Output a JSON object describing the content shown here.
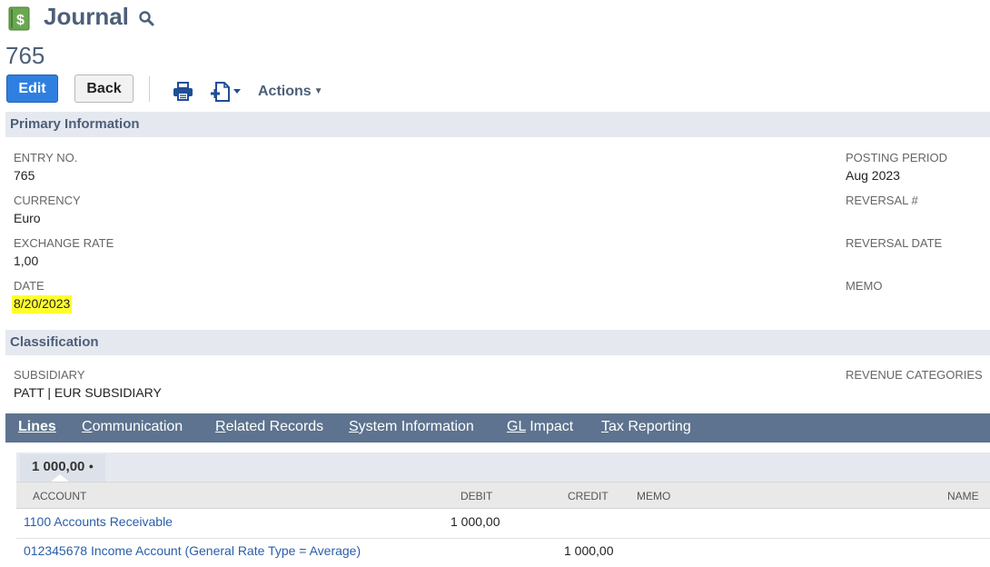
{
  "header": {
    "record_type": "Journal",
    "record_number": "765",
    "record_icon": "dollar-ledger-icon",
    "search_icon": "search-icon"
  },
  "toolbar": {
    "edit_label": "Edit",
    "back_label": "Back",
    "print_icon": "print-icon",
    "new_doc_icon": "new-document-icon",
    "actions_label": "Actions",
    "accent_color": "#2f7fe0"
  },
  "primary": {
    "title": "Primary Information",
    "entry_no_label": "ENTRY NO.",
    "entry_no_value": "765",
    "currency_label": "CURRENCY",
    "currency_value": "Euro",
    "exchange_rate_label": "EXCHANGE RATE",
    "exchange_rate_value": "1,00",
    "date_label": "DATE",
    "date_value": "8/20/2023",
    "posting_period_label": "POSTING PERIOD",
    "posting_period_value": "Aug 2023",
    "reversal_no_label": "REVERSAL #",
    "reversal_date_label": "REVERSAL DATE",
    "memo_label": "MEMO"
  },
  "classification": {
    "title": "Classification",
    "subsidiary_label": "SUBSIDIARY",
    "subsidiary_value": "PATT | EUR SUBSIDIARY",
    "revenue_categories_label": "REVENUE CATEGORIES"
  },
  "tabs": [
    {
      "label": "Lines",
      "active": true
    },
    {
      "label": "Communication",
      "active": false
    },
    {
      "label": "Related Records",
      "active": false
    },
    {
      "label": "System Information",
      "active": false
    },
    {
      "label": "GL Impact",
      "active": false
    },
    {
      "label": "Tax Reporting",
      "active": false
    }
  ],
  "lines": {
    "total_label": "1 000,00",
    "columns": {
      "account": "ACCOUNT",
      "debit": "DEBIT",
      "credit": "CREDIT",
      "memo": "MEMO",
      "name": "NAME"
    },
    "rows": [
      {
        "account": "1100 Accounts Receivable",
        "debit": "1 000,00",
        "credit": "",
        "memo": "",
        "name": ""
      },
      {
        "account": "012345678 Income Account (General Rate Type = Average)",
        "debit": "",
        "credit": "1 000,00",
        "memo": "",
        "name": ""
      }
    ]
  }
}
